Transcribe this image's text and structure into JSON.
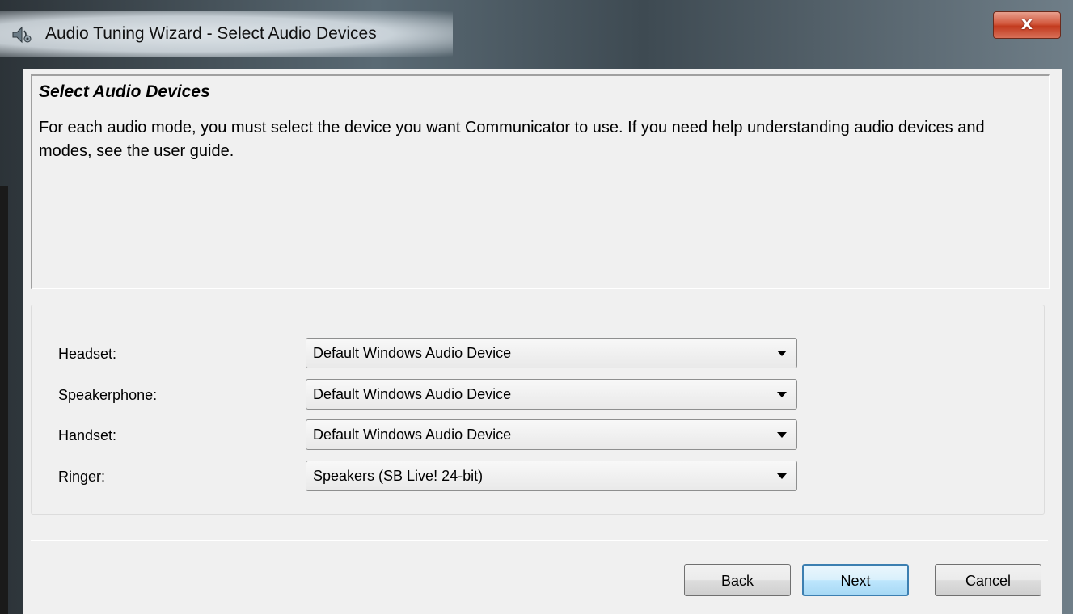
{
  "window": {
    "title": "Audio Tuning Wizard - Select Audio Devices",
    "icon": "speaker-settings-icon",
    "close_label": "x"
  },
  "header": {
    "title": "Select Audio Devices",
    "description": "For each audio mode, you must select the device you want Communicator to use. If you need help understanding audio devices and modes, see the user guide."
  },
  "devices": [
    {
      "label": "Headset:",
      "value": "Default Windows Audio Device"
    },
    {
      "label": "Speakerphone:",
      "value": "Default Windows Audio Device"
    },
    {
      "label": "Handset:",
      "value": "Default Windows Audio Device"
    },
    {
      "label": "Ringer:",
      "value": "Speakers (SB Live! 24-bit)"
    }
  ],
  "buttons": {
    "back": "Back",
    "next": "Next",
    "cancel": "Cancel"
  },
  "colors": {
    "close_button": "#c23a1e",
    "default_button_border": "#3c7fb1",
    "dialog_background": "#f0f0f0"
  }
}
